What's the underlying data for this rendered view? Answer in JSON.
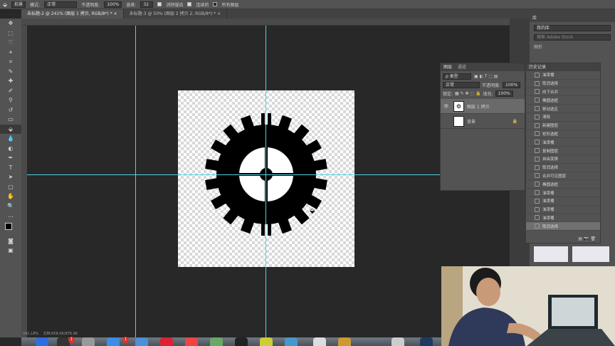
{
  "options_bar": {
    "tool_name": "前景",
    "mode_label": "模式:",
    "mode_value": "正常",
    "opacity_label": "不透明度:",
    "opacity_value": "100%",
    "tolerance_label": "容差:",
    "tolerance_value": "32",
    "antialias_label": "消除锯齿",
    "contiguous_label": "连续的",
    "all_layers_label": "所有图层"
  },
  "tabs": [
    {
      "label": "未标题-2 @ 241% (图层 1 拷贝, RGB/8*) *"
    },
    {
      "label": "未标题-3 @ 50% (图层 2 拷贝 2, RGB/8*) *"
    }
  ],
  "libraries": {
    "title": "库",
    "library_value": "我的库",
    "search_placeholder": "搜索 Adobe Stock",
    "graphics_label": "图形"
  },
  "layers_panel": {
    "tab_layers": "图层",
    "tab_channels": "通道",
    "filter_label": "ρ 类型",
    "blend_mode": "正常",
    "opacity_label": "不透明度:",
    "opacity_value": "100%",
    "lock_label": "锁定:",
    "fill_label": "填充:",
    "fill_value": "100%",
    "layers": [
      {
        "name": "图层 1 拷贝",
        "selected": true
      },
      {
        "name": "背景",
        "selected": false
      }
    ]
  },
  "history_panel": {
    "title": "历史记录",
    "items": [
      "油漆桶",
      "取消选择",
      "向下合并",
      "椭圆选框",
      "移动选区",
      "清除",
      "新建图层",
      "矩形选框",
      "油漆桶",
      "复制图层",
      "自由变换",
      "取消选择",
      "合并可见图层",
      "椭圆选框",
      "油漆桶",
      "油漆桶",
      "油漆桶",
      "油漆桶",
      "取消选择"
    ],
    "selected_index": 18
  },
  "status": {
    "zoom": "241.18%",
    "doc_info": "文档:658.0K/876.0K"
  },
  "dock": {
    "badge_1": "1",
    "badge_2": "1"
  },
  "colors": {
    "guide": "#4fd3e0",
    "panel_bg": "#535353",
    "workspace": "#282828"
  }
}
